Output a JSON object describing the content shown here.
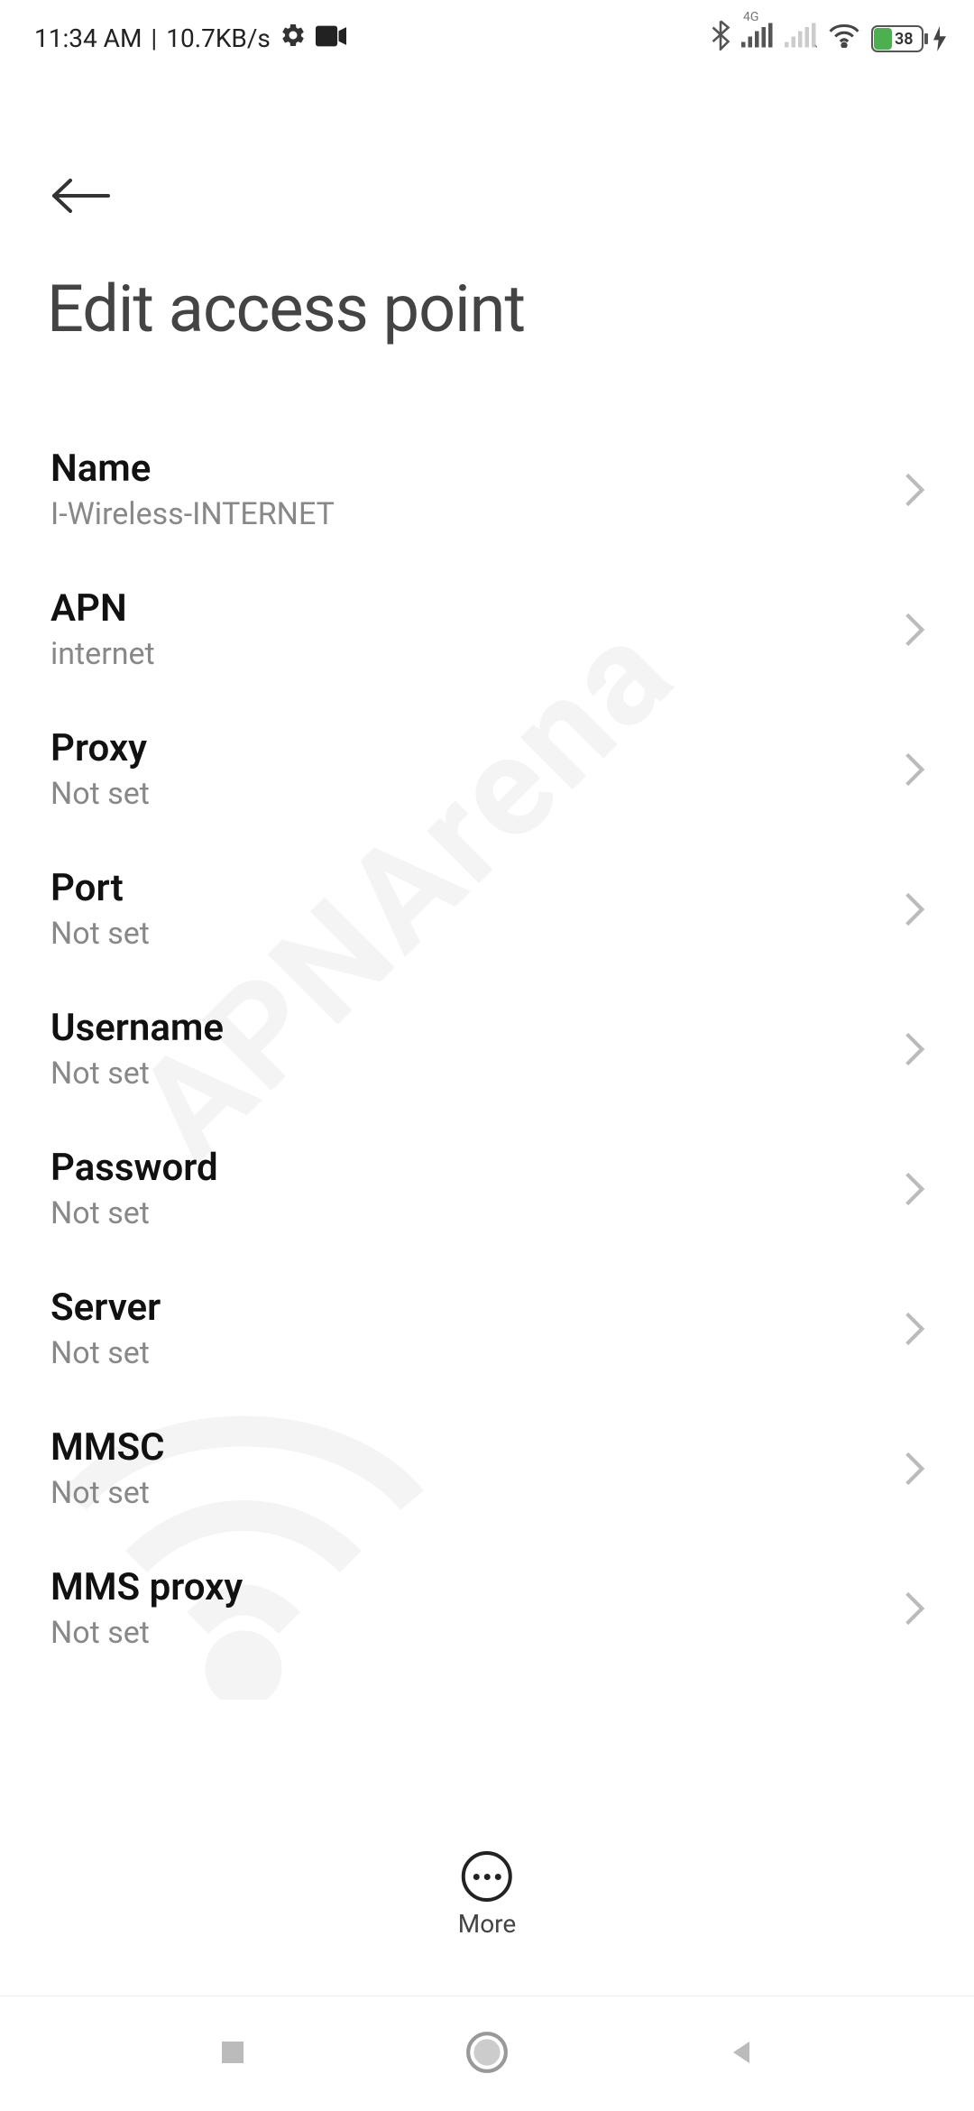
{
  "status_bar": {
    "time": "11:34 AM",
    "net_speed": "10.7KB/s",
    "battery": "38"
  },
  "header": {
    "title": "Edit access point"
  },
  "settings": [
    {
      "label": "Name",
      "value": "I-Wireless-INTERNET"
    },
    {
      "label": "APN",
      "value": "internet"
    },
    {
      "label": "Proxy",
      "value": "Not set"
    },
    {
      "label": "Port",
      "value": "Not set"
    },
    {
      "label": "Username",
      "value": "Not set"
    },
    {
      "label": "Password",
      "value": "Not set"
    },
    {
      "label": "Server",
      "value": "Not set"
    },
    {
      "label": "MMSC",
      "value": "Not set"
    },
    {
      "label": "MMS proxy",
      "value": "Not set"
    }
  ],
  "bottom_action": {
    "label": "More"
  },
  "watermark": "APNArena"
}
